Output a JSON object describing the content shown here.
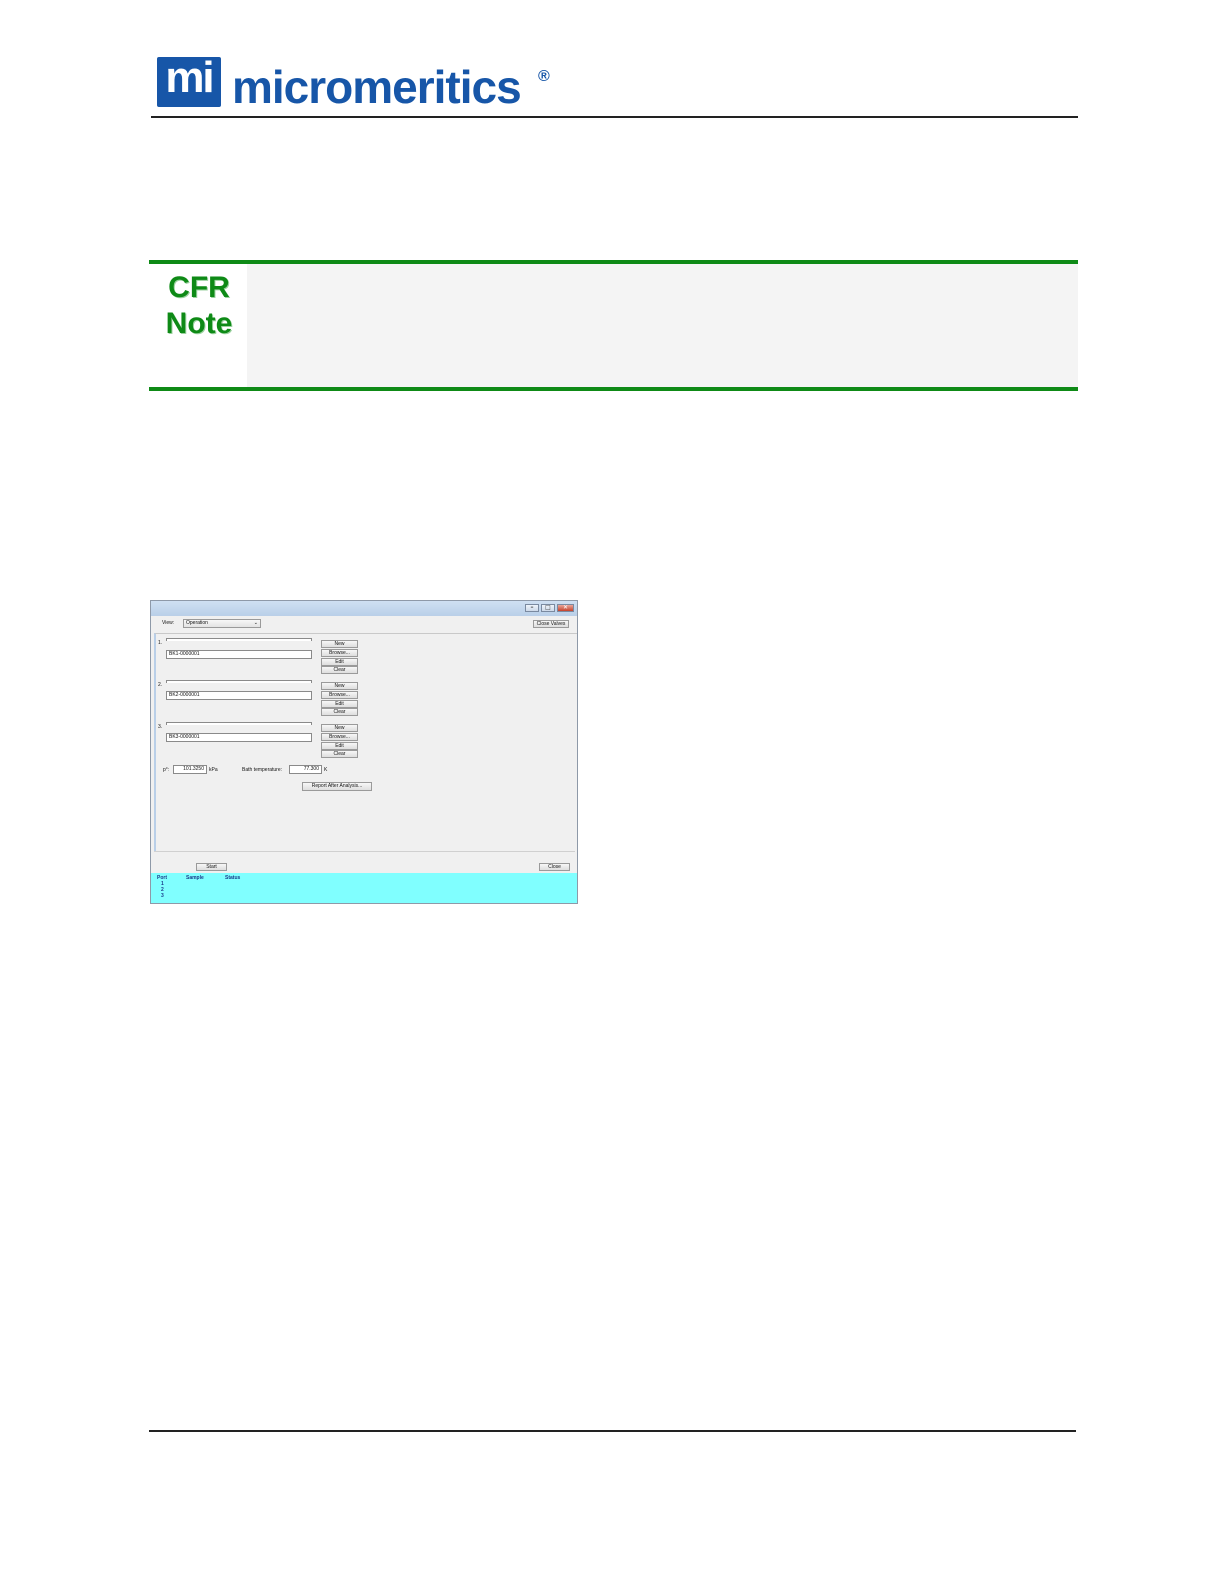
{
  "header": {
    "logo_mark": "mi",
    "brand": "micromeritics",
    "registered": "®"
  },
  "cfr_note": {
    "label_line1": "CFR",
    "label_line2": "Note"
  },
  "window": {
    "view_label": "View:",
    "view_value": "Operation",
    "close_valves": "Close Valves",
    "ports": [
      {
        "number": "1.",
        "sample": "BK1-0000001"
      },
      {
        "number": "2.",
        "sample": "BK2-0000001"
      },
      {
        "number": "3.",
        "sample": "BK3-0000001"
      }
    ],
    "buttons": {
      "new": "New",
      "browse": "Browse...",
      "edit": "Edit",
      "clear": "Clear"
    },
    "p0_label": "p°:",
    "p0_value": "101.3250",
    "p0_unit": "kPa",
    "bath_label": "Bath temperature:",
    "bath_value": "77.300",
    "bath_unit": "K",
    "report_button": "Report After Analysis...",
    "start_button": "Start",
    "close_button": "Close",
    "status_table": {
      "headers": [
        "Port",
        "Sample",
        "Status"
      ],
      "rows": [
        "1",
        "2",
        "3"
      ]
    }
  },
  "colors": {
    "brand_blue": "#1756a8",
    "cfr_green": "#0e8a16",
    "status_cyan": "#80ffff"
  }
}
